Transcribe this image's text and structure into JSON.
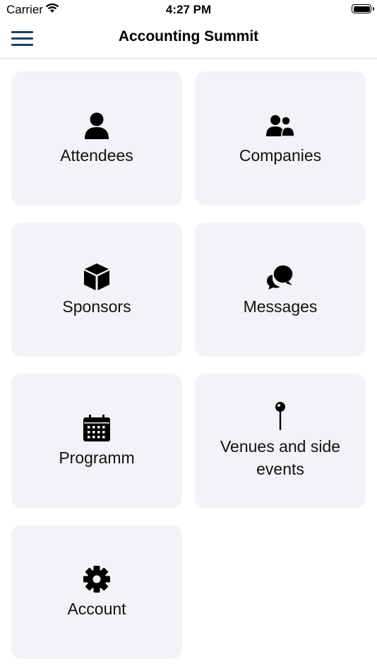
{
  "status_bar": {
    "carrier": "Carrier",
    "time": "4:27 PM"
  },
  "nav": {
    "title": "Accounting Summit"
  },
  "tiles": [
    {
      "label": "Attendees",
      "icon": "person-icon"
    },
    {
      "label": "Companies",
      "icon": "users-icon"
    },
    {
      "label": "Sponsors",
      "icon": "cube-icon"
    },
    {
      "label": "Messages",
      "icon": "chat-bubbles-icon"
    },
    {
      "label": "Programm",
      "icon": "calendar-icon"
    },
    {
      "label": "Venues and side events",
      "icon": "map-pin-icon"
    },
    {
      "label": "Account",
      "icon": "gear-icon"
    }
  ]
}
